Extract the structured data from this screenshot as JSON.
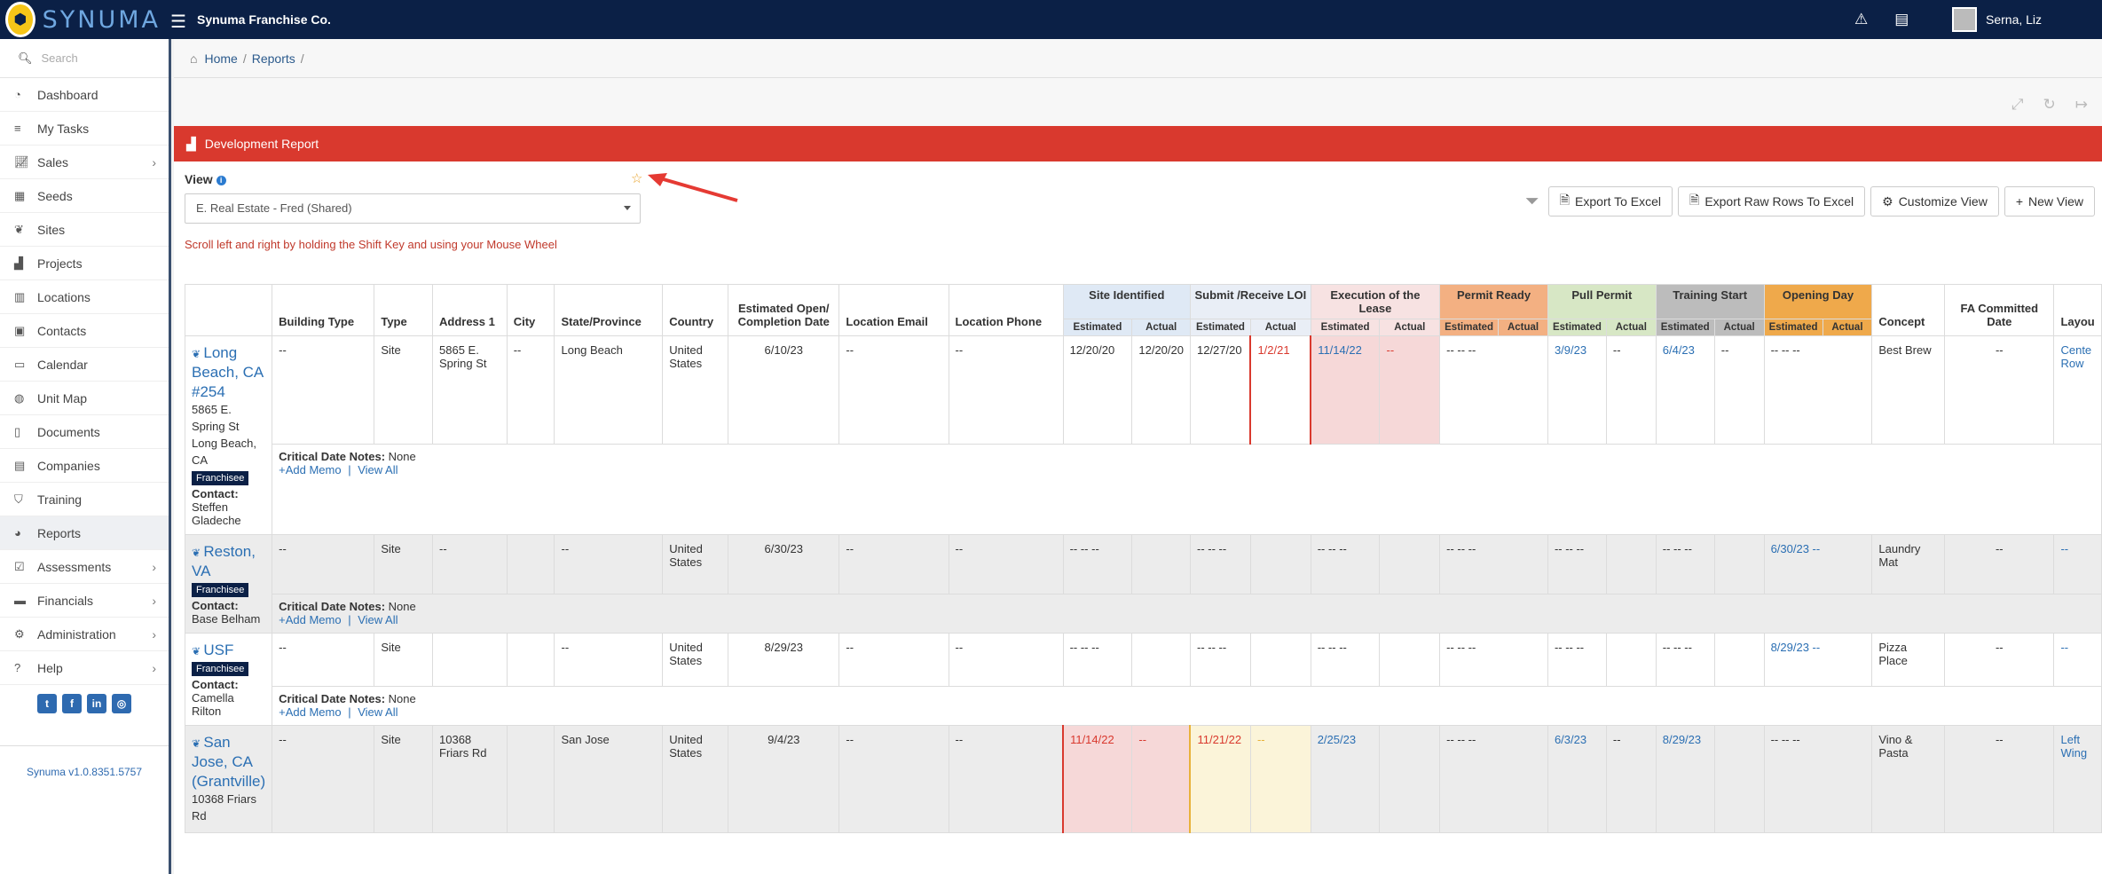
{
  "app": {
    "brand": "SYNUMA",
    "company": "Synuma Franchise Co.",
    "user": "Serna, Liz"
  },
  "sidebar": {
    "search_placeholder": "Search",
    "items": [
      {
        "label": "Dashboard",
        "icon": "dashboard-icon"
      },
      {
        "label": "My Tasks",
        "icon": "list-icon"
      },
      {
        "label": "Sales",
        "icon": "chart-icon",
        "chevron": true
      },
      {
        "label": "Seeds",
        "icon": "grid-icon"
      },
      {
        "label": "Sites",
        "icon": "leaf-icon"
      },
      {
        "label": "Projects",
        "icon": "road-icon"
      },
      {
        "label": "Locations",
        "icon": "building-icon"
      },
      {
        "label": "Contacts",
        "icon": "contact-icon"
      },
      {
        "label": "Calendar",
        "icon": "calendar-icon"
      },
      {
        "label": "Unit Map",
        "icon": "globe-icon"
      },
      {
        "label": "Documents",
        "icon": "document-icon"
      },
      {
        "label": "Companies",
        "icon": "company-icon"
      },
      {
        "label": "Training",
        "icon": "graduation-icon"
      },
      {
        "label": "Reports",
        "icon": "pie-icon",
        "active": true
      },
      {
        "label": "Assessments",
        "icon": "check-icon",
        "chevron": true
      },
      {
        "label": "Financials",
        "icon": "money-icon",
        "chevron": true
      },
      {
        "label": "Administration",
        "icon": "cogs-icon",
        "chevron": true
      },
      {
        "label": "Help",
        "icon": "question-icon",
        "chevron": true
      }
    ],
    "version": "Synuma v1.0.8351.5757"
  },
  "breadcrumb": {
    "home": "Home",
    "reports": "Reports"
  },
  "panel": {
    "title": "Development Report",
    "view_label": "View",
    "view_value": "E. Real Estate - Fred (Shared)",
    "scroll_note": "Scroll left and right by holding the Shift Key and using your Mouse Wheel"
  },
  "buttons": {
    "export_excel": "Export To Excel",
    "export_raw": "Export Raw Rows To Excel",
    "customize": "Customize View",
    "new_view": "New View"
  },
  "colors": {
    "header": "#0b2046",
    "panel": "#d9392e",
    "link": "#2b6fb3"
  },
  "table": {
    "headers": {
      "building_type": "Building Type",
      "type": "Type",
      "address1": "Address 1",
      "city": "City",
      "state": "State/Province",
      "country": "Country",
      "est_open": "Estimated Open/ Completion Date",
      "email": "Location Email",
      "phone": "Location Phone",
      "concept": "Concept",
      "fa_date": "FA Committed Date",
      "layout": "Layou"
    },
    "groups": {
      "site": "Site Identified",
      "submit": "Submit /Receive LOI",
      "exec": "Execution of the Lease",
      "permit": "Permit Ready",
      "pull": "Pull Permit",
      "train": "Training Start",
      "open": "Opening Day"
    },
    "sub": {
      "est": "Estimated",
      "act": "Actual"
    },
    "notes": {
      "label": "Critical Date Notes:",
      "value": "None",
      "add": "+Add Memo",
      "sep": "|",
      "view": "View All",
      "contact": "Contact:"
    },
    "rows": [
      {
        "name": "Long Beach, CA #254",
        "addr": "5865 E. Spring St Long Beach, CA",
        "tag": "Franchisee",
        "contact": "Steffen Gladeche",
        "building": "--",
        "type": "Site",
        "address1": "5865 E. Spring St",
        "city": "--",
        "state": "Long Beach",
        "country": "United States",
        "est_open": "6/10/23",
        "email": "--",
        "phone": "--",
        "site_est": "12/20/20",
        "site_act": "12/20/20",
        "sub_est": "12/27/20",
        "sub_act": "1/2/21",
        "exec_est": "11/14/22",
        "exec_act": "--",
        "perm": "--   --   --",
        "pull_est": "3/9/23",
        "pull_act": "--",
        "train_est": "6/4/23",
        "train_act": "--",
        "open": "--   --   --",
        "concept": "Best Brew",
        "fa": "--",
        "layout": "Cente Row"
      },
      {
        "name": "Reston, VA",
        "addr": "",
        "tag": "Franchisee",
        "contact": "Base Belham",
        "building": "--",
        "type": "Site",
        "address1": "--",
        "city": "",
        "state": "--",
        "country": "United States",
        "est_open": "6/30/23",
        "email": "--",
        "phone": "--",
        "site_est": "--   --   --",
        "site_act": "",
        "sub_est": "--   --   --",
        "sub_act": "",
        "exec_est": "--   --   --",
        "exec_act": "",
        "perm": "--   --   --",
        "pull_est": "--   --   --",
        "pull_act": "",
        "train_est": "--   --   --",
        "train_act": "",
        "open": "6/30/23   --",
        "concept": "Laundry Mat",
        "fa": "--",
        "layout": "--"
      },
      {
        "name": "USF",
        "addr": "",
        "tag": "Franchisee",
        "contact": "Camella Rilton",
        "building": "--",
        "type": "Site",
        "address1": "",
        "city": "",
        "state": "--",
        "country": "United States",
        "est_open": "8/29/23",
        "email": "--",
        "phone": "--",
        "site_est": "--   --   --",
        "site_act": "",
        "sub_est": "--   --   --",
        "sub_act": "",
        "exec_est": "--   --   --",
        "exec_act": "",
        "perm": "--   --   --",
        "pull_est": "--   --   --",
        "pull_act": "",
        "train_est": "--   --   --",
        "train_act": "",
        "open": "8/29/23   --",
        "concept": "Pizza Place",
        "fa": "--",
        "layout": "--"
      },
      {
        "name": "San Jose, CA (Grantville)",
        "addr": "10368 Friars Rd",
        "building": "--",
        "type": "Site",
        "address1": "10368 Friars Rd",
        "city": "",
        "state": "San Jose",
        "country": "United States",
        "est_open": "9/4/23",
        "email": "--",
        "phone": "--",
        "site_est": "11/14/22",
        "site_act": "--",
        "sub_est": "11/21/22",
        "sub_act": "--",
        "exec_est": "2/25/23",
        "exec_act": "",
        "perm": "--   --   --",
        "pull_est": "6/3/23",
        "pull_act": "--",
        "train_est": "8/29/23",
        "train_act": "",
        "open": "--   --   --",
        "concept": "Vino & Pasta",
        "fa": "--",
        "layout": "Left Wing"
      }
    ]
  }
}
